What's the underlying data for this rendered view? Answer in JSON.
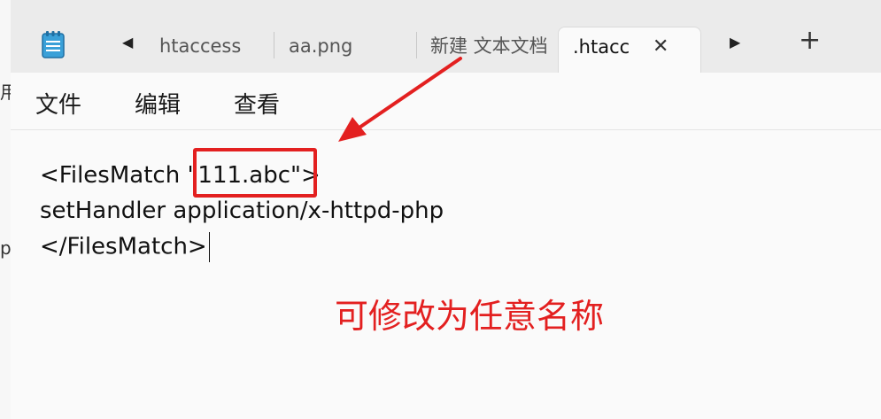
{
  "window": {
    "tabs": [
      {
        "label": "htaccess",
        "active": false
      },
      {
        "label": "aa.png",
        "active": false
      },
      {
        "label": "新建 文本文档",
        "active": false
      },
      {
        "label": ".htacc",
        "active": true
      }
    ],
    "tab_close_glyph": "✕",
    "new_tab_glyph": "+",
    "scroll_left_glyph": "◀",
    "scroll_right_glyph": "▶"
  },
  "menu": {
    "file": "文件",
    "edit": "编辑",
    "view": "查看"
  },
  "editor": {
    "line1_prefix": "<FilesMatch ",
    "line1_value": "\"111.abc\"",
    "line1_suffix": ">",
    "line2": "setHandler application/x-httpd-php",
    "line3": "</FilesMatch>"
  },
  "annotation": {
    "text": "可修改为任意名称",
    "color": "#e32020"
  },
  "background_window": {
    "fragments": [
      "用",
      "p"
    ]
  },
  "icons": {
    "app": "notepad-icon",
    "close": "close-icon",
    "scroll_left": "chevron-left-icon",
    "scroll_right": "chevron-right-icon",
    "new_tab": "plus-icon"
  }
}
